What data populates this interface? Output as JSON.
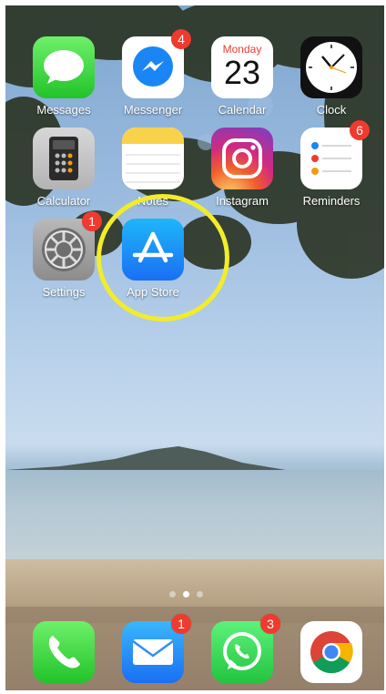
{
  "home_screen": {
    "apps": [
      {
        "label": "Messages"
      },
      {
        "label": "Messenger",
        "badge": "4"
      },
      {
        "label": "Calendar",
        "weekday": "Monday",
        "day": "23"
      },
      {
        "label": "Clock"
      },
      {
        "label": "Calculator"
      },
      {
        "label": "Notes"
      },
      {
        "label": "Instagram"
      },
      {
        "label": "Reminders",
        "badge": "6"
      },
      {
        "label": "Settings",
        "badge": "1"
      },
      {
        "label": "App Store"
      }
    ],
    "page_indicator": {
      "pages": 3,
      "current": 2
    }
  },
  "dock": {
    "apps": [
      {
        "name": "Phone"
      },
      {
        "name": "Mail",
        "badge": "1"
      },
      {
        "name": "WhatsApp",
        "badge": "3"
      },
      {
        "name": "Chrome"
      }
    ]
  },
  "annotation": {
    "shape": "circle",
    "color": "#f2ec2a",
    "target": "App Store"
  },
  "colors": {
    "badge": "#ef3b2f"
  }
}
